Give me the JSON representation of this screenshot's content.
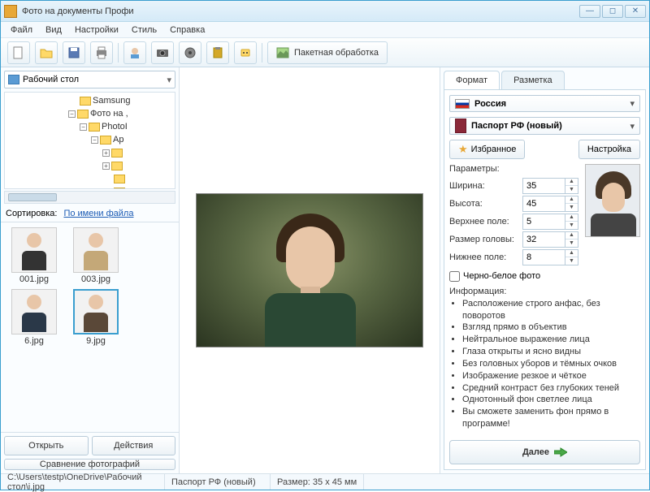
{
  "window": {
    "title": "Фото на документы Профи"
  },
  "menu": {
    "file": "Файл",
    "view": "Вид",
    "settings": "Настройки",
    "style": "Стиль",
    "help": "Справка"
  },
  "toolbar": {
    "batch": "Пакетная обработка"
  },
  "left": {
    "location": "Рабочий стол",
    "tree": {
      "n0": "Samsung",
      "n1": "Фото на ,",
      "n2": "PhotoI",
      "n3": "Ap"
    },
    "sort_label": "Сортировка:",
    "sort_value": "По имени файла",
    "thumbs": [
      {
        "name": "001.jpg"
      },
      {
        "name": "003.jpg"
      },
      {
        "name": "6.jpg"
      },
      {
        "name": "9.jpg"
      }
    ],
    "open": "Открыть",
    "actions": "Действия",
    "compare": "Сравнение фотографий"
  },
  "right": {
    "tab_format": "Формат",
    "tab_layout": "Разметка",
    "country": "Россия",
    "doctype": "Паспорт РФ (новый)",
    "favorite": "Избранное",
    "setup": "Настройка",
    "params_header": "Параметры:",
    "params": {
      "width_label": "Ширина:",
      "width": "35",
      "height_label": "Высота:",
      "height": "45",
      "top_label": "Верхнее поле:",
      "top": "5",
      "head_label": "Размер головы:",
      "head": "32",
      "bottom_label": "Нижнее поле:",
      "bottom": "8"
    },
    "bw_label": "Черно-белое фото",
    "info_header": "Информация:",
    "info": [
      "Расположение строго анфас, без поворотов",
      "Взгляд прямо в объектив",
      "Нейтральное выражение лица",
      "Глаза открыты и ясно видны",
      "Без головных уборов и тёмных очков",
      "Изображение резкое и чёткое",
      "Средний контраст без глубоких теней",
      "Однотонный фон светлее лица",
      "Вы сможете заменить фон прямо в программе!"
    ],
    "next": "Далее"
  },
  "status": {
    "path": "C:\\Users\\testp\\OneDrive\\Рабочий стол\\i.jpg",
    "doc": "Паспорт РФ (новый)",
    "size": "Размер: 35 x 45 мм"
  }
}
